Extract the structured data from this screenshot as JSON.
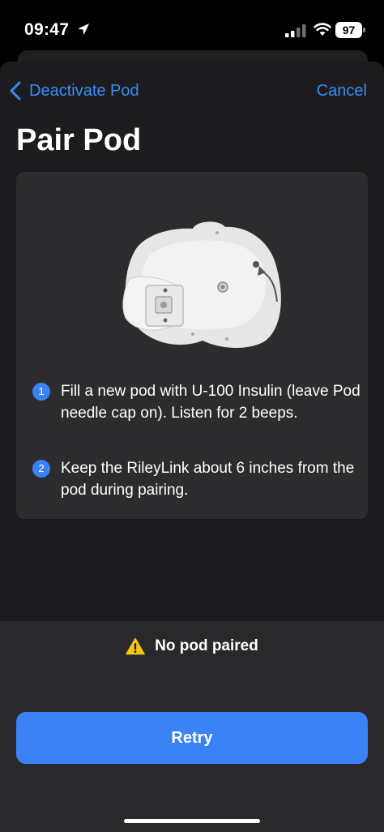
{
  "status_bar": {
    "time": "09:47",
    "battery": "97",
    "icons": [
      "location-arrow-icon",
      "cellular-signal-icon",
      "wifi-icon",
      "battery-icon"
    ]
  },
  "nav": {
    "back_label": "Deactivate Pod",
    "cancel_label": "Cancel"
  },
  "title": "Pair Pod",
  "instructions": [
    {
      "number": "1",
      "text": "Fill a new pod with U-100 Insulin (leave Pod needle cap on). Listen for 2 beeps."
    },
    {
      "number": "2",
      "text": "Keep the RileyLink about 6 inches from the pod during pairing."
    }
  ],
  "status": {
    "icon": "warning-icon",
    "text": "No pod paired"
  },
  "retry_label": "Retry",
  "colors": {
    "accent": "#3b82f6",
    "link": "#3b8cf5",
    "warning": "#f5c518",
    "sheet_background": "#1c1c1e",
    "card_background": "#2c2c2e"
  }
}
